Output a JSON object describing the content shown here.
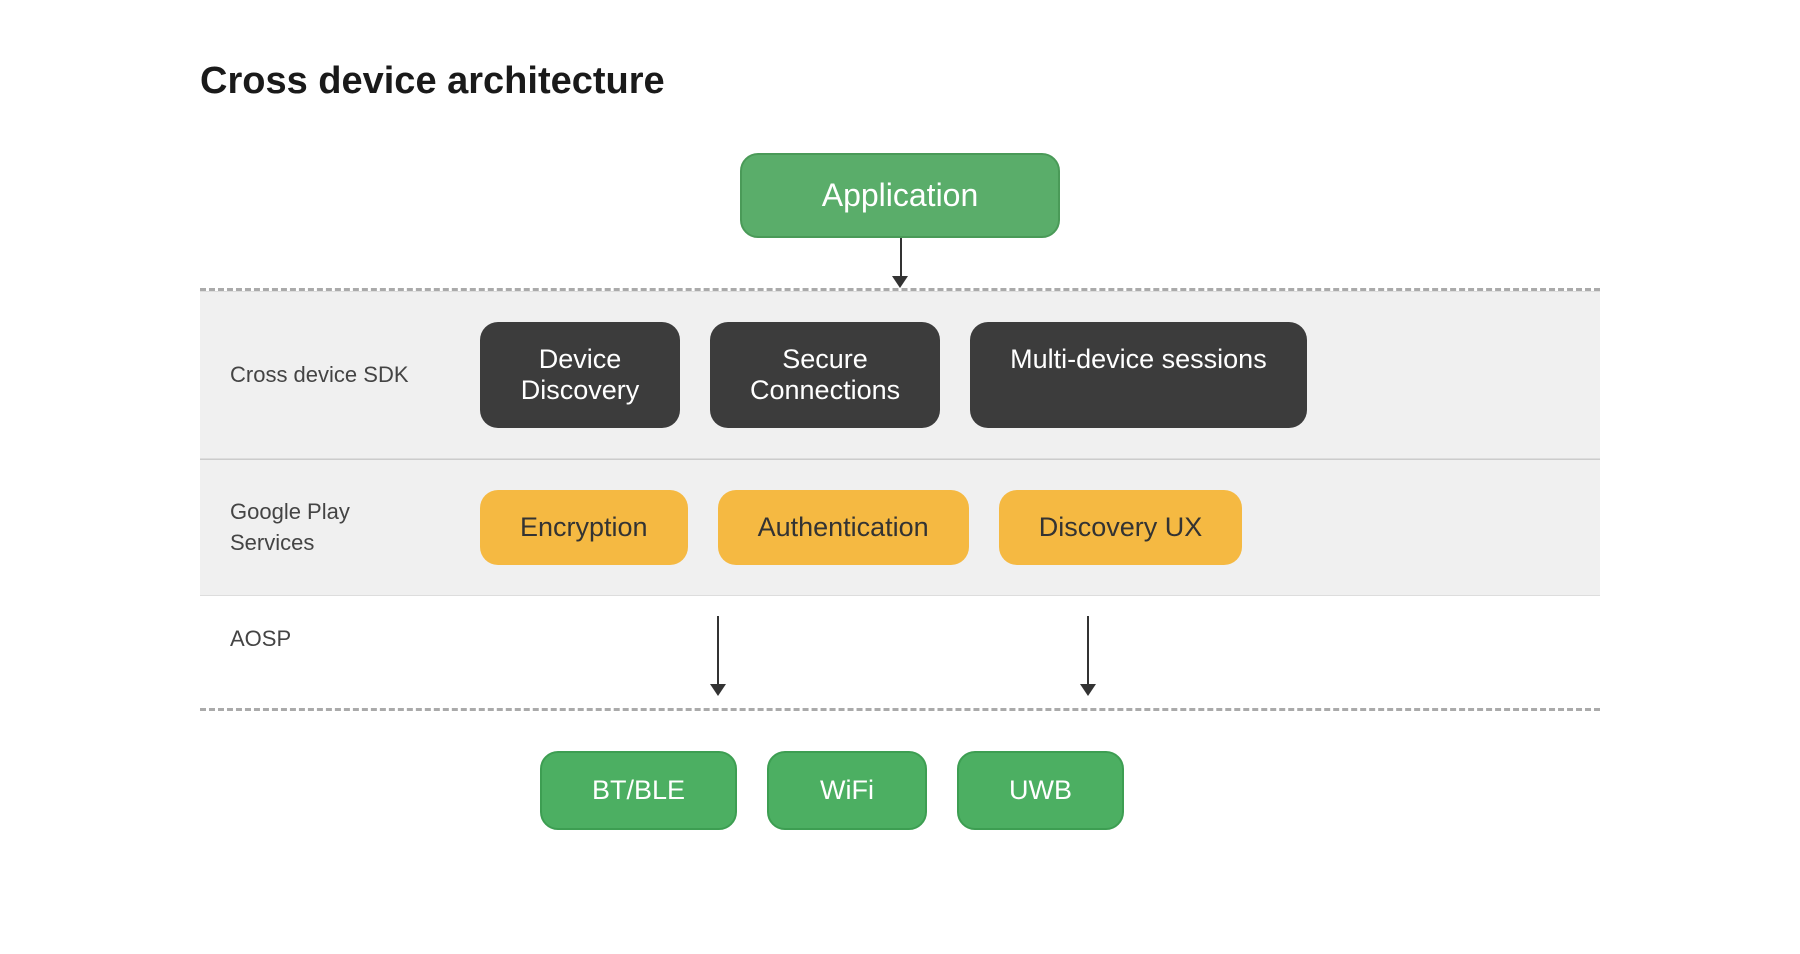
{
  "title": "Cross device architecture",
  "application_box": "Application",
  "sdk_label": "Cross device SDK",
  "sdk_items": [
    {
      "label": "Device\nDiscovery"
    },
    {
      "label": "Secure\nConnections"
    },
    {
      "label": "Multi-device sessions"
    }
  ],
  "gps_label": "Google Play\nServices",
  "gps_items": [
    {
      "label": "Encryption"
    },
    {
      "label": "Authentication"
    },
    {
      "label": "Discovery UX"
    }
  ],
  "aosp_label": "AOSP",
  "bottom_items": [
    {
      "label": "BT/BLE"
    },
    {
      "label": "WiFi"
    },
    {
      "label": "UWB"
    }
  ]
}
